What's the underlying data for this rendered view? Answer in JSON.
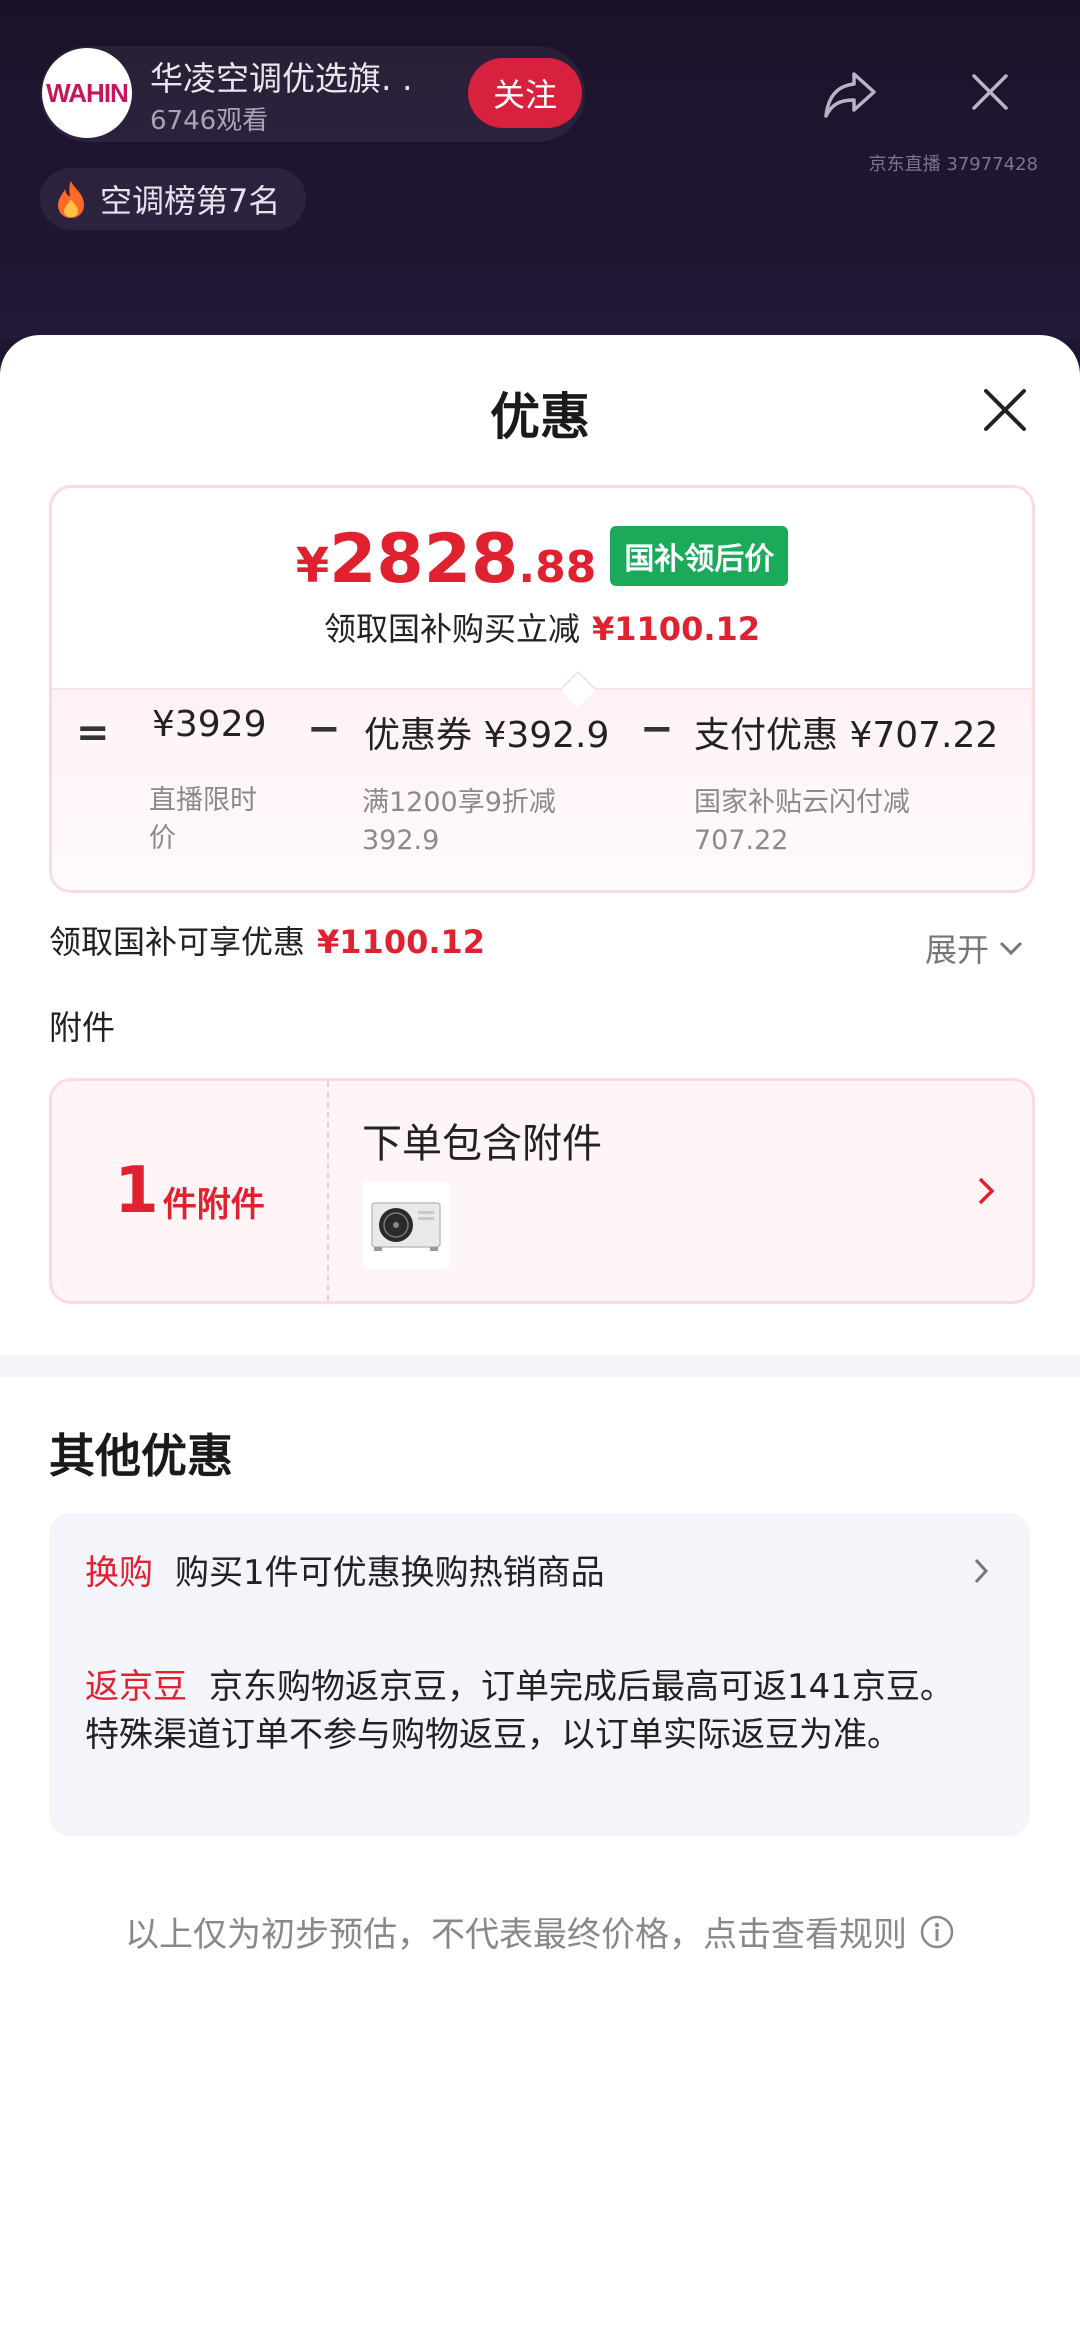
{
  "live": {
    "avatar_text": "WAHIN",
    "shop_name": "华凌空调优选旗. .",
    "viewers": "6746观看",
    "follow_label": "关注",
    "live_id": "京东直播 37977428",
    "rank_label": "空调榜第7名"
  },
  "sheet": {
    "title": "优惠",
    "price": {
      "currency": "¥",
      "integer": "2828",
      "decimal": ".88",
      "tag": "国补领后价",
      "reduce_text": "领取国补购买立减",
      "reduce_amount": "¥1100.12"
    },
    "breakdown": {
      "equals": "=",
      "minus": "−",
      "live_price": "¥3929",
      "live_price_desc_1": "直播限时",
      "live_price_desc_2": "价",
      "coupon": "优惠券 ¥392.9",
      "coupon_desc_1": "满1200享9折减",
      "coupon_desc_2": "392.9",
      "pay": "支付优惠 ¥707.22",
      "pay_desc_1": "国家补贴云闪付减",
      "pay_desc_2": "707.22"
    },
    "claim_text": "领取国补可享优惠",
    "claim_amount": "¥1100.12",
    "expand_label": "展开",
    "accessory": {
      "section_title": "附件",
      "count": "1",
      "count_unit": "件附件",
      "text": "下单包含附件"
    },
    "other": {
      "title": "其他优惠",
      "exchange_tag": "换购",
      "exchange_text": "购买1件可优惠换购热销商品",
      "beans_tag": "返京豆",
      "beans_text": "京东购物返京豆，订单完成后最高可返141京豆。特殊渠道订单不参与购物返豆，以订单实际返豆为准。"
    },
    "disclaimer": "以上仅为初步预估，不代表最终价格，点击查看规则"
  },
  "colors": {
    "accent_red": "#e0212f",
    "subsidy_green": "#1aaa5a",
    "follow_red": "#d8203f"
  },
  "icons": [
    "share-icon",
    "close-icon",
    "fire-icon",
    "chevron-down-icon",
    "chevron-right-icon",
    "info-icon"
  ]
}
